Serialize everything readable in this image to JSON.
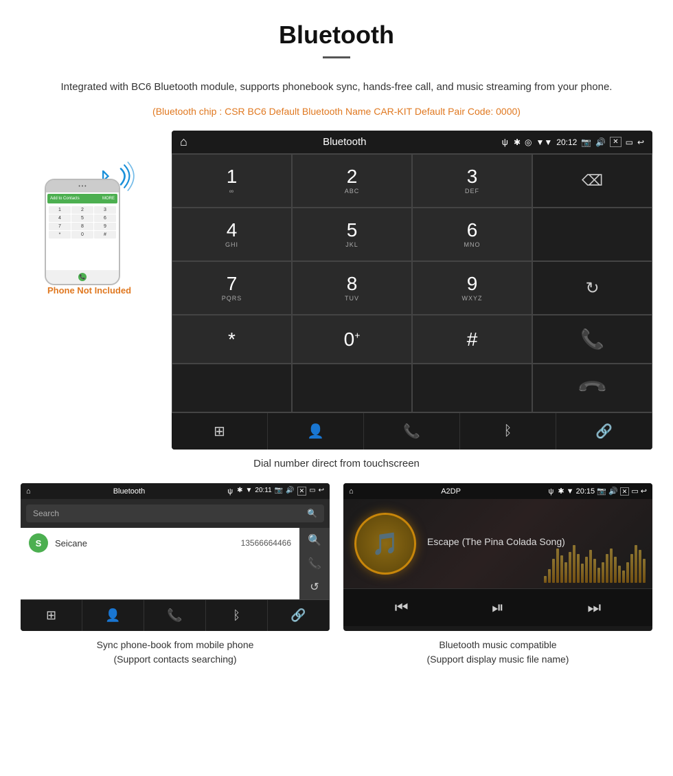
{
  "page": {
    "title": "Bluetooth",
    "divider": true,
    "description": "Integrated with BC6 Bluetooth module, supports phonebook sync, hands-free call, and music streaming from your phone.",
    "specs": "(Bluetooth chip : CSR BC6    Default Bluetooth Name CAR-KIT    Default Pair Code: 0000)",
    "dial_caption": "Dial number direct from touchscreen",
    "lower_left_caption": "Sync phone-book from mobile phone\n(Support contacts searching)",
    "lower_right_caption": "Bluetooth music compatible\n(Support display music file name)",
    "phone_not_included": "Phone Not Included"
  },
  "dial_screen": {
    "status": {
      "home": "⌂",
      "title": "Bluetooth",
      "usb": "ψ",
      "bt": "✱",
      "location": "◎",
      "signal": "▼",
      "time": "20:12",
      "camera": "📷",
      "volume": "🔊",
      "x_box": "✕",
      "window": "▭",
      "back": "↩"
    },
    "keys": [
      {
        "num": "1",
        "sub": "∞"
      },
      {
        "num": "2",
        "sub": "ABC"
      },
      {
        "num": "3",
        "sub": "DEF"
      },
      {
        "num": "",
        "sub": "",
        "icon": "backspace"
      },
      {
        "num": "4",
        "sub": "GHI"
      },
      {
        "num": "5",
        "sub": "JKL"
      },
      {
        "num": "6",
        "sub": "MNO"
      },
      {
        "num": "",
        "sub": "",
        "empty": true
      },
      {
        "num": "7",
        "sub": "PQRS"
      },
      {
        "num": "8",
        "sub": "TUV"
      },
      {
        "num": "9",
        "sub": "WXYZ"
      },
      {
        "num": "",
        "sub": "",
        "icon": "refresh"
      },
      {
        "num": "*",
        "sub": ""
      },
      {
        "num": "0",
        "sub": "+"
      },
      {
        "num": "#",
        "sub": ""
      },
      {
        "num": "",
        "sub": "",
        "icon": "call-green"
      },
      {
        "num": "",
        "sub": "",
        "empty": true
      },
      {
        "num": "",
        "sub": "",
        "empty": true
      },
      {
        "num": "",
        "sub": "",
        "empty": true
      },
      {
        "num": "",
        "sub": "",
        "icon": "call-red"
      }
    ],
    "bottom_nav": [
      "grid",
      "person",
      "phone",
      "bluetooth",
      "link"
    ]
  },
  "phonebook_screen": {
    "status": {
      "home": "⌂",
      "title": "Bluetooth",
      "usb": "ψ",
      "bt_icon": "✱",
      "signal": "▼",
      "time": "20:11"
    },
    "search_placeholder": "Search",
    "contacts": [
      {
        "initial": "S",
        "name": "Seicane",
        "number": "13566664466"
      }
    ],
    "right_icons": [
      "🔍",
      "📞",
      "↺"
    ],
    "bottom_nav": [
      "grid",
      "person",
      "phone",
      "bluetooth",
      "link"
    ]
  },
  "music_screen": {
    "status": {
      "home": "⌂",
      "title": "A2DP",
      "usb": "ψ",
      "bt_icon": "✱",
      "signal": "▼",
      "time": "20:15"
    },
    "track_title": "Escape (The Pina Colada Song)",
    "album_icon": "🎵",
    "controls": [
      "⏮",
      "⏯",
      "⏭"
    ],
    "visualizer_bars": [
      10,
      20,
      35,
      50,
      40,
      30,
      45,
      55,
      42,
      28,
      38,
      48,
      35,
      22,
      30,
      42,
      50,
      38,
      25,
      18,
      30,
      42,
      55,
      48,
      35
    ]
  },
  "phone_mockup": {
    "top_dots": "• • •",
    "green_bar_left": "Add to Contacts",
    "green_bar_right": "MORE",
    "dial_keys": [
      "1",
      "2",
      "3",
      "4",
      "5",
      "6",
      "7",
      "8",
      "9",
      "*",
      "0",
      "#"
    ],
    "call_symbol": "📞"
  }
}
